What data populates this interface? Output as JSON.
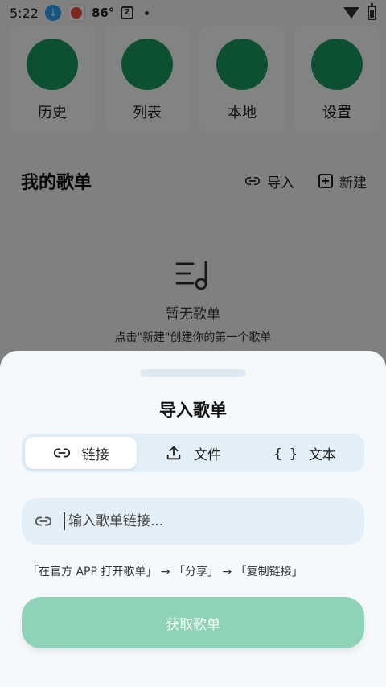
{
  "status_bar": {
    "time": "5:22",
    "temperature": "86°",
    "icons": [
      "download-notification-icon",
      "app-notification-icon",
      "z-app-icon",
      "dot-icon",
      "wifi-icon",
      "battery-icon"
    ]
  },
  "quick_actions": [
    {
      "label": "历史",
      "icon": "history-circle-icon"
    },
    {
      "label": "列表",
      "icon": "list-circle-icon"
    },
    {
      "label": "本地",
      "icon": "local-circle-icon"
    },
    {
      "label": "设置",
      "icon": "settings-circle-icon"
    }
  ],
  "playlist_section": {
    "title": "我的歌单",
    "import_label": "导入",
    "new_label": "新建"
  },
  "empty_state": {
    "title": "暂无歌单",
    "hint": "点击\"新建\"创建你的第一个歌单"
  },
  "import_sheet": {
    "title": "导入歌单",
    "tabs": [
      {
        "label": "链接",
        "icon": "link-icon",
        "active": true
      },
      {
        "label": "文件",
        "icon": "upload-icon",
        "active": false
      },
      {
        "label": "文本",
        "icon": "braces-icon",
        "active": false
      }
    ],
    "input": {
      "placeholder": "输入歌单链接...",
      "value": ""
    },
    "hint": "「在官方 APP 打开歌单」 → 「分享」 → 「复制链接」",
    "fetch_button": "获取歌单"
  },
  "colors": {
    "accent_green": "#1a9a5e",
    "button_green_disabled": "#8ed3b8",
    "sheet_background": "#f5f9fc",
    "field_background": "#e2eef8"
  }
}
